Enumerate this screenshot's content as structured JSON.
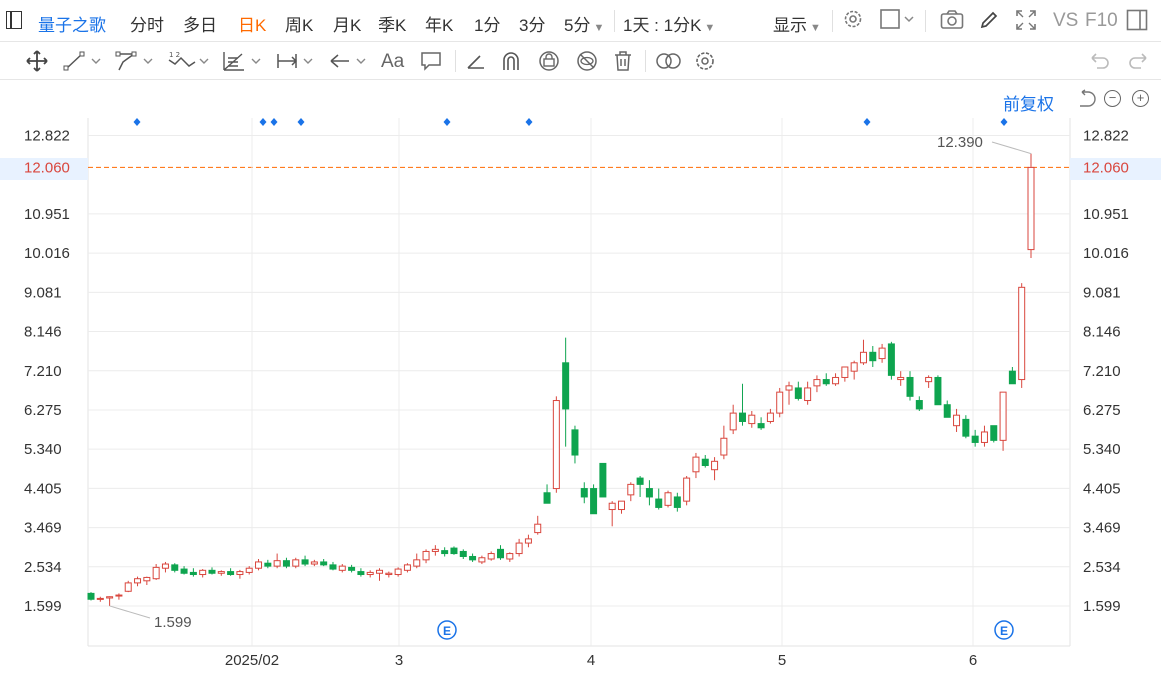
{
  "toolbar": {
    "stock_name": "量子之歌",
    "periods": [
      "分时",
      "多日",
      "日K",
      "周K",
      "月K",
      "季K",
      "年K",
      "1分",
      "3分",
      "5分"
    ],
    "active_period": "日K",
    "intraday_setting": "1天 : 1分K",
    "display_label": "显示",
    "vs_label": "VS",
    "f10_label": "F10"
  },
  "drawing_tools": {
    "icons": [
      "move-icon",
      "line-icon",
      "polyline-icon",
      "wave-icon",
      "measure-icon",
      "range-icon",
      "arrow-icon",
      "text-icon",
      "comment-icon",
      "ruler-icon",
      "magnet-icon",
      "lock-icon",
      "hide-icon",
      "delete-icon",
      "compare-icon",
      "settings-icon",
      "undo-icon",
      "redo-icon"
    ],
    "text_tool_label": "Aa"
  },
  "adjust": {
    "label": "前复权"
  },
  "colors": {
    "up": "#d9463d",
    "down": "#0ea44f",
    "accent": "#1a73e8",
    "orange": "#ff6a00",
    "grid": "#ececec"
  },
  "chart_data": {
    "type": "candlestick",
    "y_ticks": [
      "12.822",
      "12.060",
      "10.951",
      "10.016",
      "9.081",
      "8.146",
      "7.210",
      "6.275",
      "5.340",
      "4.405",
      "3.469",
      "2.534",
      "1.599"
    ],
    "highlighted_price": "12.060",
    "x_labels": [
      "2025/02",
      "3",
      "4",
      "5",
      "6"
    ],
    "max_label": "12.390",
    "min_label": "1.599",
    "event_marker_label": "E",
    "candles": [
      [
        1.9,
        1.93,
        1.73,
        1.76
      ],
      [
        1.76,
        1.82,
        1.7,
        1.78
      ],
      [
        1.79,
        1.83,
        1.6,
        1.82
      ],
      [
        1.84,
        1.9,
        1.75,
        1.86
      ],
      [
        1.95,
        2.2,
        1.93,
        2.15
      ],
      [
        2.15,
        2.3,
        2.07,
        2.25
      ],
      [
        2.2,
        2.3,
        2.1,
        2.28
      ],
      [
        2.25,
        2.6,
        2.22,
        2.52
      ],
      [
        2.5,
        2.65,
        2.4,
        2.6
      ],
      [
        2.58,
        2.62,
        2.4,
        2.45
      ],
      [
        2.48,
        2.55,
        2.35,
        2.38
      ],
      [
        2.4,
        2.5,
        2.3,
        2.35
      ],
      [
        2.35,
        2.48,
        2.28,
        2.45
      ],
      [
        2.45,
        2.52,
        2.35,
        2.38
      ],
      [
        2.38,
        2.45,
        2.32,
        2.42
      ],
      [
        2.42,
        2.5,
        2.32,
        2.35
      ],
      [
        2.35,
        2.46,
        2.25,
        2.42
      ],
      [
        2.4,
        2.55,
        2.35,
        2.5
      ],
      [
        2.5,
        2.72,
        2.45,
        2.65
      ],
      [
        2.62,
        2.7,
        2.5,
        2.55
      ],
      [
        2.55,
        2.85,
        2.5,
        2.68
      ],
      [
        2.68,
        2.75,
        2.5,
        2.55
      ],
      [
        2.55,
        2.75,
        2.5,
        2.7
      ],
      [
        2.7,
        2.8,
        2.55,
        2.6
      ],
      [
        2.6,
        2.7,
        2.55,
        2.65
      ],
      [
        2.65,
        2.72,
        2.55,
        2.58
      ],
      [
        2.58,
        2.65,
        2.45,
        2.48
      ],
      [
        2.45,
        2.6,
        2.4,
        2.55
      ],
      [
        2.52,
        2.58,
        2.4,
        2.45
      ],
      [
        2.42,
        2.5,
        2.3,
        2.35
      ],
      [
        2.35,
        2.45,
        2.28,
        2.4
      ],
      [
        2.38,
        2.5,
        2.2,
        2.45
      ],
      [
        2.35,
        2.42,
        2.28,
        2.38
      ],
      [
        2.35,
        2.52,
        2.3,
        2.48
      ],
      [
        2.45,
        2.62,
        2.4,
        2.58
      ],
      [
        2.55,
        2.85,
        2.5,
        2.7
      ],
      [
        2.7,
        2.95,
        2.62,
        2.9
      ],
      [
        2.9,
        3.05,
        2.8,
        2.95
      ],
      [
        2.92,
        3.0,
        2.78,
        2.85
      ],
      [
        2.98,
        3.02,
        2.82,
        2.85
      ],
      [
        2.9,
        2.95,
        2.72,
        2.78
      ],
      [
        2.78,
        2.85,
        2.65,
        2.7
      ],
      [
        2.65,
        2.8,
        2.6,
        2.75
      ],
      [
        2.72,
        2.9,
        2.68,
        2.85
      ],
      [
        2.95,
        3.05,
        2.7,
        2.75
      ],
      [
        2.72,
        2.88,
        2.65,
        2.85
      ],
      [
        2.85,
        3.2,
        2.78,
        3.1
      ],
      [
        3.1,
        3.3,
        3.0,
        3.2
      ],
      [
        3.35,
        3.75,
        3.3,
        3.55
      ],
      [
        4.3,
        4.5,
        4.1,
        4.05
      ],
      [
        4.4,
        6.6,
        4.3,
        6.5
      ],
      [
        7.4,
        8.0,
        5.4,
        6.3
      ],
      [
        5.8,
        5.9,
        5.0,
        5.2
      ],
      [
        4.4,
        4.55,
        4.05,
        4.2
      ],
      [
        4.4,
        4.5,
        3.8,
        3.8
      ],
      [
        5.0,
        5.0,
        4.2,
        4.2
      ],
      [
        3.9,
        4.1,
        3.5,
        4.05
      ],
      [
        3.9,
        4.1,
        3.8,
        4.1
      ],
      [
        4.25,
        4.55,
        4.1,
        4.5
      ],
      [
        4.65,
        4.7,
        4.2,
        4.5
      ],
      [
        4.4,
        4.6,
        4.0,
        4.2
      ],
      [
        4.15,
        4.4,
        3.9,
        3.95
      ],
      [
        4.0,
        4.35,
        3.95,
        4.3
      ],
      [
        4.2,
        4.3,
        3.85,
        3.95
      ],
      [
        4.1,
        4.7,
        4.0,
        4.65
      ],
      [
        4.8,
        5.25,
        4.65,
        5.15
      ],
      [
        5.1,
        5.2,
        4.9,
        4.95
      ],
      [
        4.85,
        5.15,
        4.6,
        5.05
      ],
      [
        5.2,
        5.9,
        5.1,
        5.6
      ],
      [
        5.8,
        6.4,
        5.7,
        6.2
      ],
      [
        6.2,
        6.9,
        5.9,
        6.0
      ],
      [
        5.95,
        6.25,
        5.85,
        6.15
      ],
      [
        5.95,
        6.1,
        5.8,
        5.85
      ],
      [
        6.0,
        6.3,
        5.95,
        6.2
      ],
      [
        6.2,
        6.8,
        6.1,
        6.7
      ],
      [
        6.75,
        6.95,
        6.4,
        6.85
      ],
      [
        6.8,
        6.95,
        6.5,
        6.55
      ],
      [
        6.5,
        6.95,
        6.4,
        6.8
      ],
      [
        6.85,
        7.1,
        6.7,
        7.0
      ],
      [
        7.0,
        7.15,
        6.85,
        6.9
      ],
      [
        6.9,
        7.15,
        6.85,
        7.05
      ],
      [
        7.05,
        7.3,
        6.95,
        7.3
      ],
      [
        7.2,
        7.45,
        7.0,
        7.4
      ],
      [
        7.4,
        7.95,
        7.35,
        7.65
      ],
      [
        7.65,
        7.8,
        7.3,
        7.45
      ],
      [
        7.5,
        7.85,
        7.4,
        7.75
      ],
      [
        7.85,
        7.9,
        7.0,
        7.1
      ],
      [
        7.0,
        7.2,
        6.85,
        7.05
      ],
      [
        7.05,
        7.2,
        6.5,
        6.6
      ],
      [
        6.5,
        6.6,
        6.25,
        6.3
      ],
      [
        6.95,
        7.1,
        6.8,
        7.05
      ],
      [
        7.05,
        7.1,
        6.4,
        6.4
      ],
      [
        6.4,
        6.5,
        6.1,
        6.1
      ],
      [
        5.9,
        6.3,
        5.75,
        6.15
      ],
      [
        6.05,
        6.15,
        5.6,
        5.65
      ],
      [
        5.65,
        5.8,
        5.4,
        5.5
      ],
      [
        5.5,
        5.9,
        5.4,
        5.75
      ],
      [
        5.9,
        5.9,
        5.5,
        5.55
      ],
      [
        5.55,
        6.7,
        5.3,
        6.7
      ],
      [
        7.2,
        7.3,
        6.9,
        6.9
      ],
      [
        7.0,
        9.3,
        6.8,
        9.2
      ],
      [
        10.1,
        12.39,
        9.9,
        12.06
      ]
    ]
  }
}
